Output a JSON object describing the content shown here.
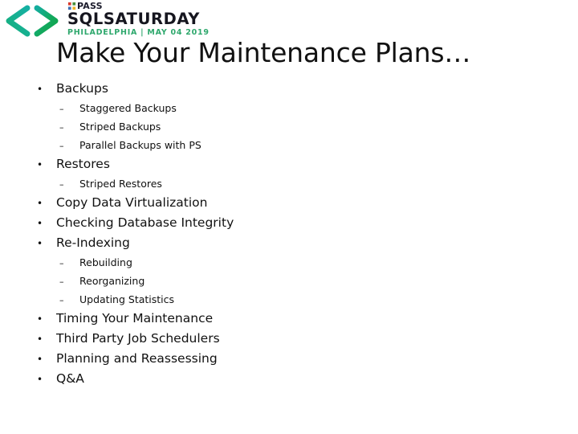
{
  "slide": {
    "background_color": "#ffffff",
    "title": "Make Your Maintenance Plans…"
  },
  "logo": {
    "mark_icon": "code-brackets-icon",
    "mark_gradient_start": "#19b2a6",
    "mark_gradient_end": "#12a74f",
    "pass_icon": "pass-pinwheel-icon",
    "pass_label": "PASS",
    "event_name": "SQLSATURDAY",
    "event_location_date": "PHILADELPHIA | MAY 04 2019",
    "event_name_color": "#16161f",
    "location_date_color": "#2fa86d"
  },
  "content": {
    "bullets": [
      {
        "level": 1,
        "marker": "•",
        "text": "Backups"
      },
      {
        "level": 2,
        "marker": "–",
        "text": "Staggered Backups"
      },
      {
        "level": 2,
        "marker": "–",
        "text": "Striped Backups"
      },
      {
        "level": 2,
        "marker": "–",
        "text": "Parallel Backups with PS"
      },
      {
        "level": 1,
        "marker": "•",
        "text": "Restores"
      },
      {
        "level": 2,
        "marker": "–",
        "text": "Striped Restores"
      },
      {
        "level": 1,
        "marker": "•",
        "text": "Copy Data Virtualization"
      },
      {
        "level": 1,
        "marker": "•",
        "text": "Checking Database Integrity"
      },
      {
        "level": 1,
        "marker": "•",
        "text": "Re-Indexing"
      },
      {
        "level": 2,
        "marker": "–",
        "text": "Rebuilding"
      },
      {
        "level": 2,
        "marker": "–",
        "text": "Reorganizing"
      },
      {
        "level": 2,
        "marker": "–",
        "text": "Updating Statistics"
      },
      {
        "level": 1,
        "marker": "•",
        "text": "Timing Your Maintenance"
      },
      {
        "level": 1,
        "marker": "•",
        "text": "Third Party Job Schedulers"
      },
      {
        "level": 1,
        "marker": "•",
        "text": "Planning and Reassessing"
      },
      {
        "level": 1,
        "marker": "•",
        "text": "Q&A"
      }
    ]
  }
}
